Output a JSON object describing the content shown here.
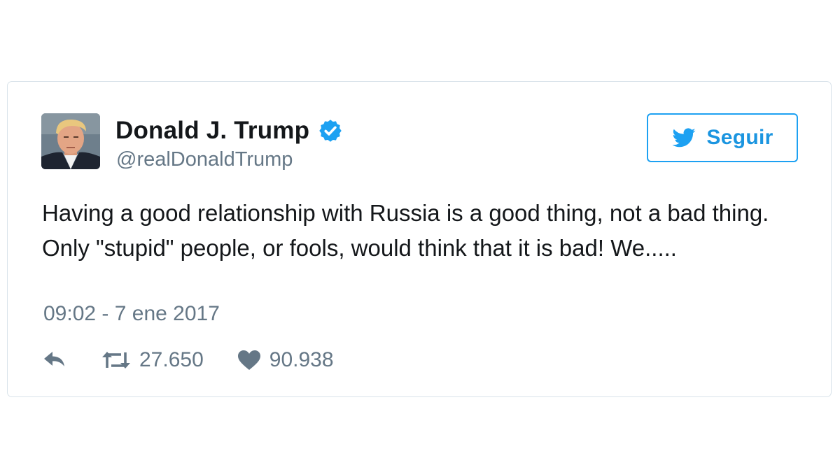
{
  "tweet": {
    "author": {
      "display_name": "Donald J. Trump",
      "handle": "@realDonaldTrump",
      "verified": true,
      "avatar_icon": "profile-photo"
    },
    "follow_button": {
      "label": "Seguir",
      "icon": "twitter-bird-icon"
    },
    "text": "Having a good relationship with Russia is a good thing, not a bad thing. Only \"stupid\" people, or fools, would think that it is bad! We.....",
    "timestamp": "09:02 - 7 ene 2017",
    "actions": {
      "reply_icon": "reply-icon",
      "retweet_icon": "retweet-icon",
      "retweet_count": "27.650",
      "like_icon": "heart-icon",
      "like_count": "90.938"
    }
  },
  "colors": {
    "accent": "#1da1f2",
    "text_primary": "#14171a",
    "text_secondary": "#657786",
    "border": "#d9e3ea"
  }
}
